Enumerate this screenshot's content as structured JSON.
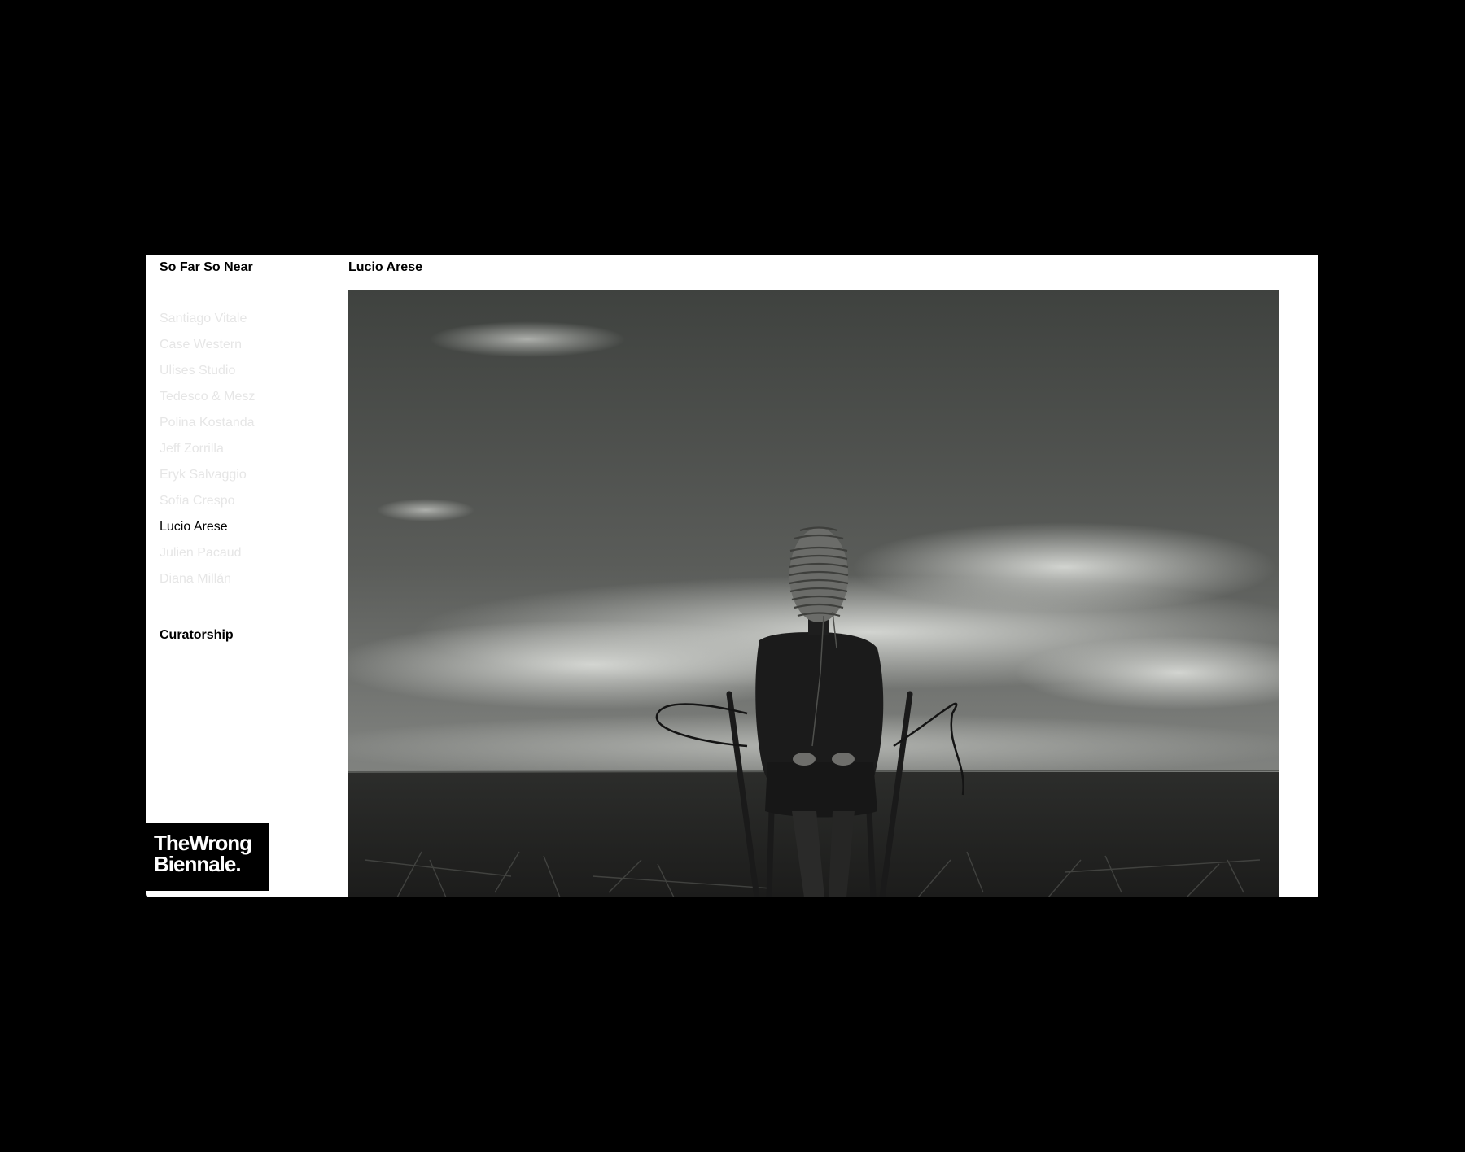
{
  "sidebar": {
    "title": "So Far So Near",
    "artists": [
      {
        "label": "Santiago Vitale",
        "active": false
      },
      {
        "label": "Case Western",
        "active": false
      },
      {
        "label": "Ulises Studio",
        "active": false
      },
      {
        "label": "Tedesco & Mesz",
        "active": false
      },
      {
        "label": "Polina Kostanda",
        "active": false
      },
      {
        "label": "Jeff Zorrilla",
        "active": false
      },
      {
        "label": "Eryk Salvaggio",
        "active": false
      },
      {
        "label": "Sofia Crespo",
        "active": false
      },
      {
        "label": "Lucio Arese",
        "active": true
      },
      {
        "label": "Julien Pacaud",
        "active": false
      },
      {
        "label": "Diana Millán",
        "active": false
      }
    ],
    "curatorship_label": "Curatorship",
    "logo": {
      "line1": "TheWrong",
      "line2": "Biennale."
    }
  },
  "main": {
    "artwork_title": "Lucio Arese"
  },
  "colors": {
    "page_background": "#000000",
    "panel_background": "#ffffff",
    "inactive_item": "#e6e6e6",
    "active_item": "#000000"
  }
}
